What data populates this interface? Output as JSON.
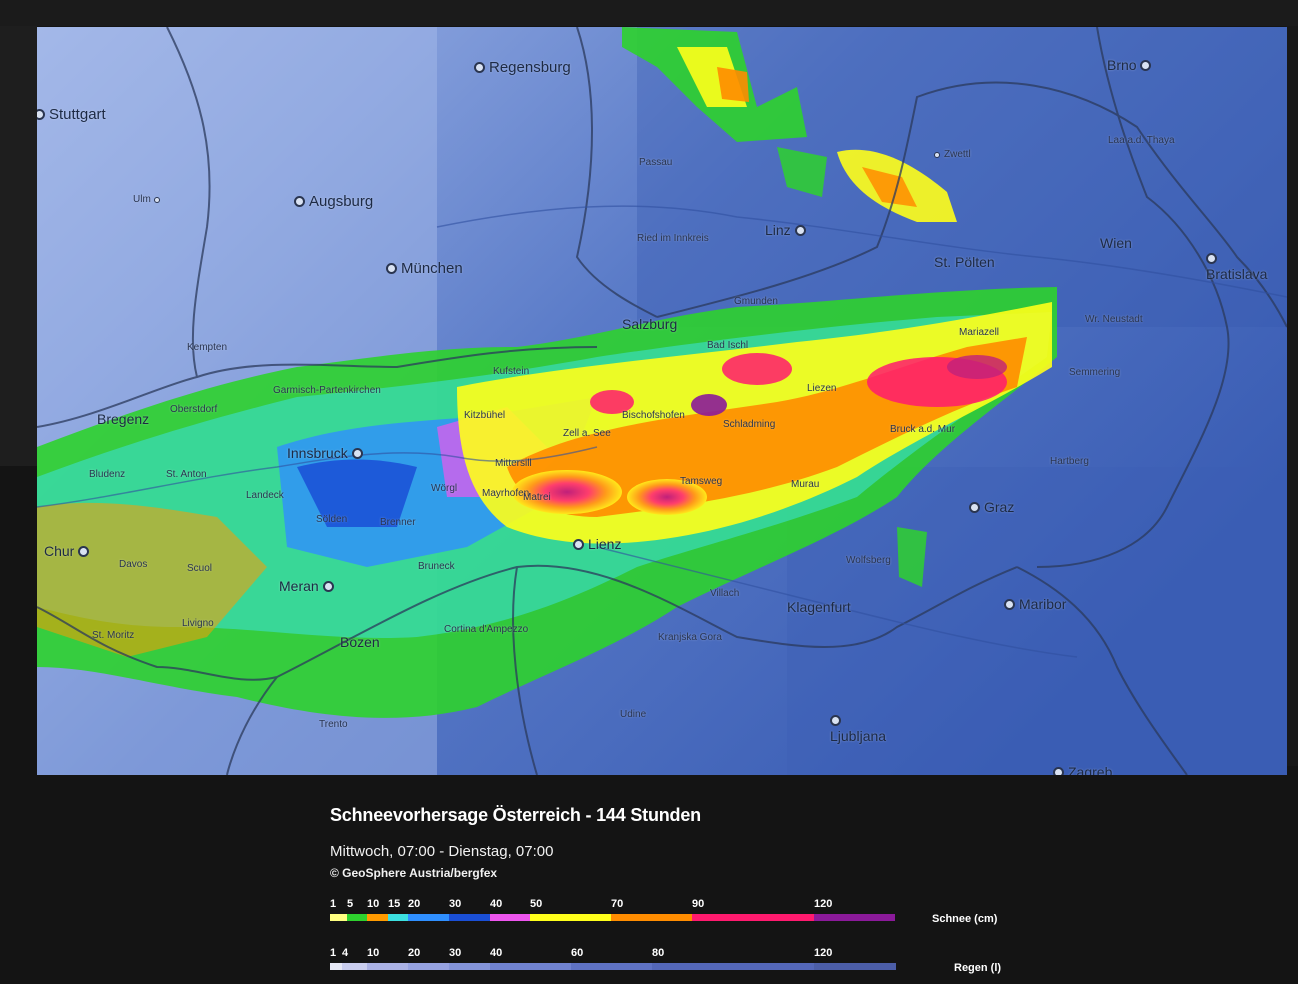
{
  "map": {
    "title": "Schneevorhersage Österreich - 144 Stunden",
    "period": "Mittwoch, 07:00 - Dienstag, 07:00",
    "copyright": "© GeoSphere Austria/bergfex",
    "cities_large": [
      {
        "name": "Regensburg"
      },
      {
        "name": "Stuttgart"
      },
      {
        "name": "Augsburg"
      },
      {
        "name": "München"
      },
      {
        "name": "Brno"
      },
      {
        "name": "Linz"
      },
      {
        "name": "Wien"
      },
      {
        "name": "St. Pölten"
      },
      {
        "name": "Bratislava"
      },
      {
        "name": "Salzburg"
      },
      {
        "name": "Bregenz"
      },
      {
        "name": "Innsbruck"
      },
      {
        "name": "Chur"
      },
      {
        "name": "Meran"
      },
      {
        "name": "Bozen"
      },
      {
        "name": "Lienz"
      },
      {
        "name": "Graz"
      },
      {
        "name": "Klagenfurt"
      },
      {
        "name": "Maribor"
      },
      {
        "name": "Ljubljana"
      },
      {
        "name": "Zagreb"
      }
    ],
    "cities_small": [
      {
        "name": "Ulm"
      },
      {
        "name": "Passau"
      },
      {
        "name": "Zwettl"
      },
      {
        "name": "Laa a.d. Thaya"
      },
      {
        "name": "Ried im Innkreis"
      },
      {
        "name": "Kempten"
      },
      {
        "name": "Gmunden"
      },
      {
        "name": "Wr. Neustadt"
      },
      {
        "name": "Mariazell"
      },
      {
        "name": "Bad Ischl"
      },
      {
        "name": "Kufstein"
      },
      {
        "name": "Bischofshofen"
      },
      {
        "name": "Liezen"
      },
      {
        "name": "Semmering"
      },
      {
        "name": "Garmisch-Partenkirchen"
      },
      {
        "name": "Kitzbühel"
      },
      {
        "name": "Oberstdorf"
      },
      {
        "name": "Zell a. See"
      },
      {
        "name": "Schladming"
      },
      {
        "name": "Bruck a.d. Mur"
      },
      {
        "name": "Hartberg"
      },
      {
        "name": "Bludenz"
      },
      {
        "name": "St. Anton"
      },
      {
        "name": "Mittersill"
      },
      {
        "name": "Wörgl"
      },
      {
        "name": "Tamsweg"
      },
      {
        "name": "Murau"
      },
      {
        "name": "Landeck"
      },
      {
        "name": "Mayrhofen"
      },
      {
        "name": "Matrei"
      },
      {
        "name": "Sölden"
      },
      {
        "name": "Brenner"
      },
      {
        "name": "Davos"
      },
      {
        "name": "Scuol"
      },
      {
        "name": "Wolfsberg"
      },
      {
        "name": "Bruneck"
      },
      {
        "name": "Villach"
      },
      {
        "name": "St. Moritz"
      },
      {
        "name": "Livigno"
      },
      {
        "name": "Cortina d'Ampezzo"
      },
      {
        "name": "Kranjska Gora"
      },
      {
        "name": "Udine"
      },
      {
        "name": "Trento"
      }
    ]
  },
  "legend_snow": {
    "unit_label": "Schnee (cm)",
    "ticks": [
      "1",
      "5",
      "10",
      "15",
      "20",
      "30",
      "40",
      "50",
      "70",
      "90",
      "120"
    ],
    "bands": [
      {
        "color": "#ffff80"
      },
      {
        "color": "#2ed12e"
      },
      {
        "color": "#ff9a00"
      },
      {
        "color": "#3ce0e0"
      },
      {
        "color": "#2f8fff"
      },
      {
        "color": "#1a4fd6"
      },
      {
        "color": "#ee55ee"
      },
      {
        "color": "#ffff1a"
      },
      {
        "color": "#ff8c00"
      },
      {
        "color": "#ff1a6e"
      },
      {
        "color": "#8b1a9a"
      }
    ]
  },
  "legend_rain": {
    "unit_label": "Regen (l)",
    "ticks": [
      "1",
      "4",
      "10",
      "20",
      "30",
      "40",
      "60",
      "80",
      "120"
    ],
    "bands": [
      {
        "color": "#e6e8f6"
      },
      {
        "color": "#c9cdee"
      },
      {
        "color": "#aab1e4"
      },
      {
        "color": "#96a2e0"
      },
      {
        "color": "#8494d8"
      },
      {
        "color": "#7082cf"
      },
      {
        "color": "#5f72c3"
      },
      {
        "color": "#5467b8"
      },
      {
        "color": "#4c5ea8"
      }
    ]
  }
}
